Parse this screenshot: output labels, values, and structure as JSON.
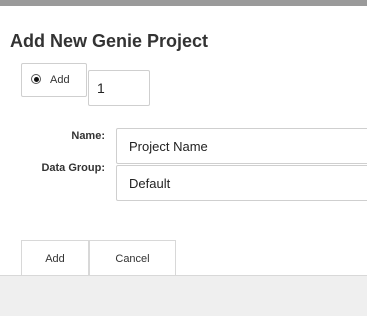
{
  "dialog": {
    "title": "Add New Genie Project",
    "count": {
      "add_label": "Add",
      "value": "1",
      "radio_selected": true
    },
    "fields": {
      "name_label": "Name:",
      "name_value": "Project Name",
      "group_label": "Data Group:",
      "group_value": "Default"
    },
    "buttons": {
      "add_label": "Add",
      "cancel_label": "Cancel"
    }
  }
}
